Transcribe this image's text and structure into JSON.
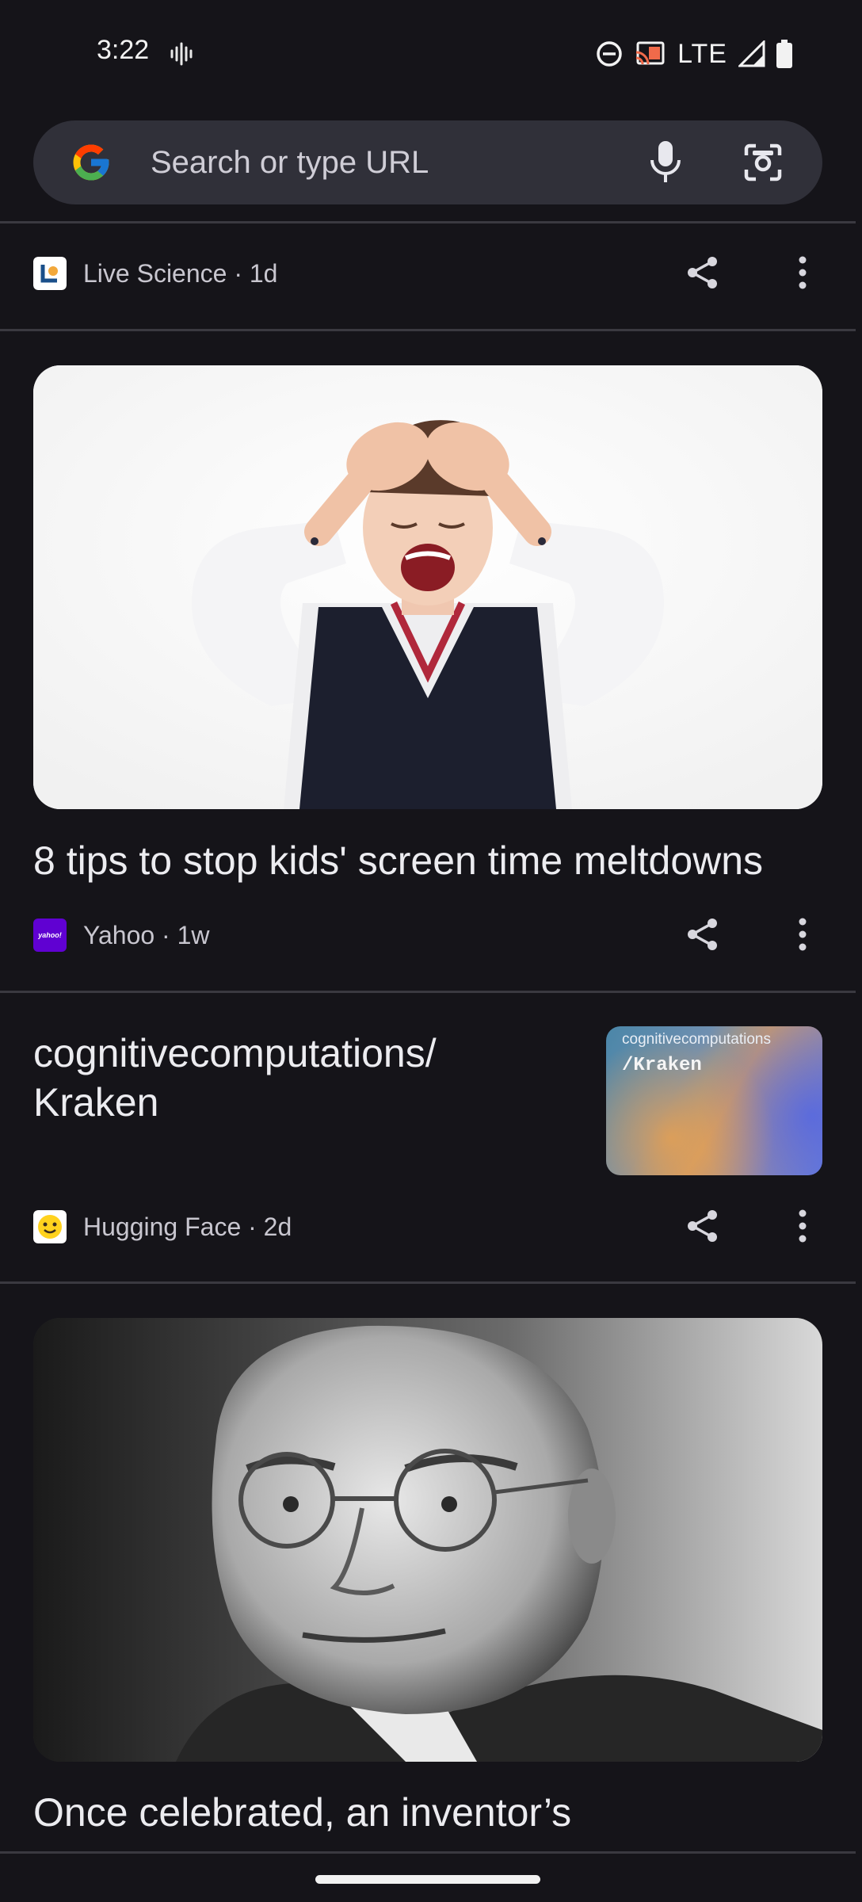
{
  "status_bar": {
    "time": "3:22",
    "network": "LTE"
  },
  "search": {
    "placeholder": "Search or type URL"
  },
  "feed": [
    {
      "source": "Live Science · 1d"
    },
    {
      "headline": "8 tips to stop kids' screen time meltdowns",
      "source": "Yahoo · 1w"
    },
    {
      "headline": "cognitivecomputations/ Kraken",
      "thumb_caption": "cognitivecomputations",
      "thumb_title": "/Kraken",
      "source": "Hugging Face · 2d"
    },
    {
      "headline": "Once celebrated, an inventor’s"
    }
  ],
  "colors": {
    "background": "#151419",
    "search_bar": "#303039",
    "divider": "#3a3940"
  }
}
